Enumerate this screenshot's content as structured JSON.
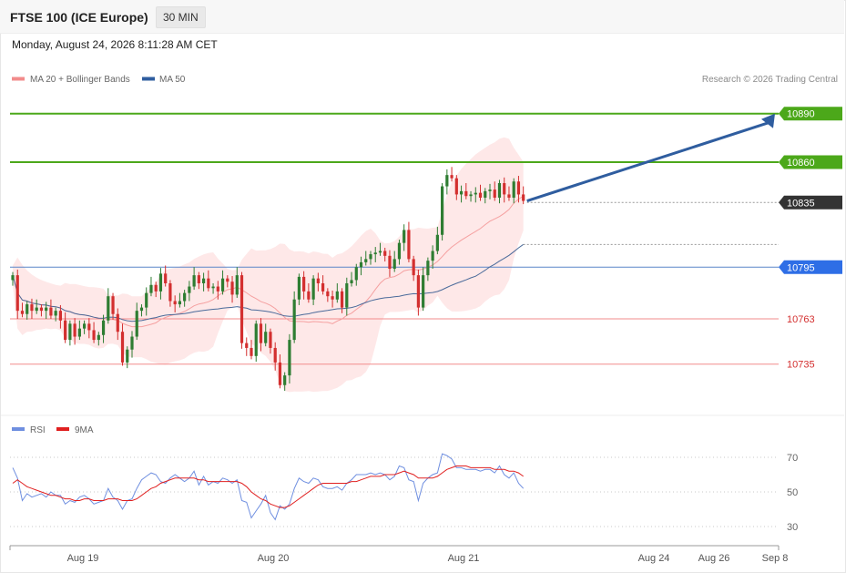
{
  "header": {
    "title": "FTSE 100 (ICE Europe)",
    "interval": "30 MIN"
  },
  "datetime": "Monday, August 24, 2026 8:11:28 AM CET",
  "copyright": "Research © 2026 Trading Central",
  "colors": {
    "bullish": "#2e7d32",
    "bearish": "#d32f2f",
    "resistance": "#4ca81a",
    "support": "#f28b8b",
    "pivot": "#2e6ee6",
    "current": "#333333",
    "ma20": "#f5a0a0",
    "ma50": "#4a6a9a",
    "band": "#fde0e0",
    "arrow": "#2f5d9f",
    "rsi": "#6f8fe0",
    "rsi_ma": "#e02020"
  },
  "chart_data": [
    {
      "type": "candlestick",
      "title": "FTSE 100 (ICE Europe)",
      "interval": "30 MIN",
      "legend": [
        {
          "label": "MA 20 + Bollinger Bands",
          "color": "#f28b8b"
        },
        {
          "label": "MA 50",
          "color": "#2f5d9f"
        }
      ],
      "ylim": [
        10701,
        10900
      ],
      "x_labels": [
        "Aug 19",
        "Aug 20",
        "Aug 21",
        "Aug 24",
        "Aug 26",
        "Sep 8"
      ],
      "levels": [
        {
          "value": 10890,
          "label": "10890",
          "kind": "resistance"
        },
        {
          "value": 10860,
          "label": "10860",
          "kind": "resistance"
        },
        {
          "value": 10835,
          "label": "10835",
          "kind": "current"
        },
        {
          "value": 10795,
          "label": "10795",
          "kind": "pivot"
        },
        {
          "value": 10763,
          "label": "10763",
          "kind": "support"
        },
        {
          "value": 10735,
          "label": "10735",
          "kind": "support"
        }
      ],
      "forecast_target": 10890,
      "close": [
        10790,
        10768,
        10766,
        10772,
        10768,
        10770,
        10768,
        10770,
        10765,
        10768,
        10762,
        10750,
        10760,
        10752,
        10757,
        10760,
        10756,
        10750,
        10753,
        10762,
        10777,
        10766,
        10755,
        10736,
        10744,
        10752,
        10768,
        10770,
        10779,
        10784,
        10780,
        10791,
        10785,
        10774,
        10772,
        10774,
        10779,
        10783,
        10790,
        10785,
        10788,
        10782,
        10783,
        10780,
        10788,
        10786,
        10778,
        10790,
        10748,
        10745,
        10740,
        10760,
        10748,
        10755,
        10745,
        10736,
        10722,
        10728,
        10750,
        10775,
        10789,
        10780,
        10775,
        10788,
        10785,
        10780,
        10777,
        10775,
        10780,
        10770,
        10785,
        10787,
        10795,
        10798,
        10800,
        10803,
        10804,
        10805,
        10802,
        10794,
        10800,
        10810,
        10818,
        10800,
        10790,
        10770,
        10790,
        10799,
        10805,
        10815,
        10845,
        10852,
        10850,
        10840,
        10842,
        10839,
        10840,
        10841,
        10838,
        10842,
        10843,
        10838,
        10847,
        10840,
        10838,
        10848,
        10840,
        10836
      ]
    },
    {
      "type": "line",
      "legend": [
        {
          "label": "RSI",
          "color": "#6f8fe0"
        },
        {
          "label": "9MA",
          "color": "#e02020"
        }
      ],
      "ylim": [
        30,
        70
      ],
      "y_ticks": [
        70,
        50,
        30
      ],
      "series": [
        {
          "name": "RSI",
          "values": [
            64,
            58,
            45,
            49,
            47,
            48,
            49,
            47,
            50,
            48,
            48,
            43,
            45,
            44,
            47,
            48,
            46,
            43,
            44,
            45,
            52,
            47,
            45,
            40,
            45,
            46,
            52,
            57,
            59,
            61,
            60,
            56,
            55,
            58,
            60,
            58,
            56,
            58,
            62,
            54,
            59,
            54,
            56,
            55,
            58,
            57,
            55,
            57,
            45,
            44,
            35,
            39,
            43,
            48,
            38,
            34,
            42,
            40,
            43,
            52,
            58,
            56,
            55,
            58,
            57,
            53,
            52,
            52,
            53,
            51,
            55,
            57,
            60,
            60,
            60,
            61,
            60,
            61,
            60,
            57,
            59,
            65,
            64,
            57,
            56,
            45,
            55,
            58,
            60,
            61,
            72,
            71,
            69,
            64,
            64,
            63,
            63,
            63,
            62,
            63,
            63,
            61,
            65,
            60,
            58,
            61,
            55,
            52
          ]
        },
        {
          "name": "9MA",
          "values": [
            55,
            57,
            55,
            53,
            52,
            51,
            50,
            49,
            48,
            48,
            47,
            46,
            46,
            45,
            45,
            46,
            46,
            45,
            45,
            45,
            46,
            46,
            46,
            45,
            45,
            45,
            46,
            48,
            50,
            52,
            53,
            55,
            56,
            57,
            58,
            58,
            58,
            58,
            58,
            57,
            57,
            56,
            56,
            56,
            56,
            56,
            56,
            56,
            55,
            53,
            50,
            48,
            46,
            45,
            43,
            42,
            41,
            41,
            42,
            44,
            46,
            48,
            50,
            52,
            54,
            55,
            55,
            55,
            55,
            55,
            55,
            56,
            56,
            57,
            58,
            59,
            59,
            59,
            60,
            60,
            60,
            61,
            62,
            61,
            60,
            58,
            58,
            58,
            58,
            59,
            61,
            63,
            64,
            65,
            65,
            65,
            64,
            64,
            64,
            64,
            64,
            63,
            63,
            63,
            62,
            62,
            61,
            59
          ]
        }
      ]
    }
  ]
}
